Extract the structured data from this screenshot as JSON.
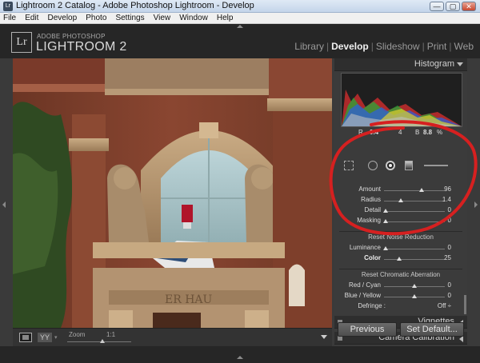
{
  "window": {
    "title": "Lightroom 2 Catalog - Adobe Photoshop Lightroom - Develop",
    "minimize": "—",
    "maximize": "▢",
    "close": "✕"
  },
  "menu": [
    "File",
    "Edit",
    "Develop",
    "Photo",
    "Settings",
    "View",
    "Window",
    "Help"
  ],
  "brand": {
    "badge": "Lr",
    "line1": "ADOBE PHOTOSHOP",
    "line2": "LIGHTROOM 2"
  },
  "modules": {
    "items": [
      "Library",
      "Develop",
      "Slideshow",
      "Print",
      "Web"
    ],
    "active": "Develop"
  },
  "histogram": {
    "title": "Histogram",
    "readout": {
      "r_label": "R",
      "r_value": "9.4",
      "g_value": "4",
      "b_label": "B",
      "b_value": "8.8",
      "unit": "%"
    }
  },
  "sharpening": {
    "rows": [
      {
        "label": "Amount",
        "value": "96",
        "pos": 0.62
      },
      {
        "label": "Radius",
        "value": "1.4",
        "pos": 0.28
      },
      {
        "label": "Detail",
        "value": "0",
        "pos": 0.03
      },
      {
        "label": "Masking",
        "value": "0",
        "pos": 0.03
      }
    ]
  },
  "noise": {
    "title": "Reset Noise Reduction",
    "rows": [
      {
        "label": "Luminance",
        "value": "0",
        "pos": 0.03
      },
      {
        "label": "Color",
        "value": "25",
        "pos": 0.25
      }
    ]
  },
  "chromatic": {
    "title": "Reset Chromatic Aberration",
    "rows": [
      {
        "label": "Red / Cyan",
        "value": "0",
        "pos": 0.5
      },
      {
        "label": "Blue / Yellow",
        "value": "0",
        "pos": 0.5
      }
    ],
    "defringe_label": "Defringe :",
    "defringe_value": "Off ÷"
  },
  "panels": {
    "vignettes": "Vignettes",
    "camera_calibration": "Camera Calibration"
  },
  "buttons": {
    "previous": "Previous",
    "set_default": "Set Default..."
  },
  "toolbar": {
    "zoom_label": "Zoom",
    "zoom_value": "1:1",
    "yy_label": "YY",
    "caret": "▾",
    "zoom_pos": 0.55
  },
  "colors": {
    "annotation": "#d62020",
    "panel_bg": "#3b3b3b"
  }
}
